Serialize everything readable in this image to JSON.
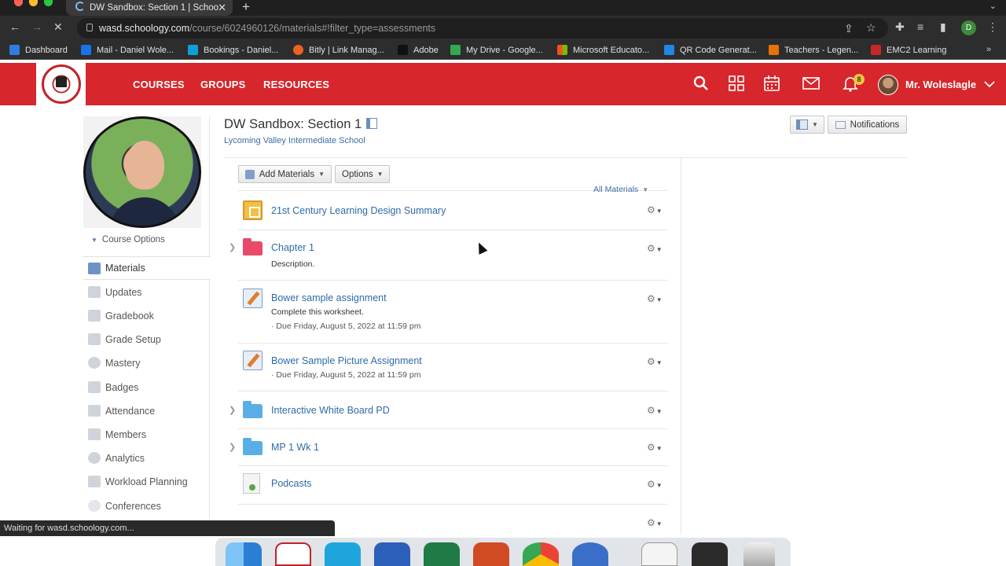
{
  "browser": {
    "tab_title": "DW Sandbox: Section 1 | Schoo",
    "url_host": "wasd.schoology.com",
    "url_path": "/course/6024960126/materials#!filter_type=assessments",
    "profile_letter": "D",
    "bookmarks": [
      {
        "label": "Dashboard",
        "color": "#2f7de1"
      },
      {
        "label": "Mail - Daniel Wole...",
        "color": "#1a73e8"
      },
      {
        "label": "Bookings - Daniel...",
        "color": "#0f9fd8"
      },
      {
        "label": "Bitly | Link Manag...",
        "color": "#ee6123"
      },
      {
        "label": "Adobe",
        "color": "#111111"
      },
      {
        "label": "My Drive - Google...",
        "color": "#34a853"
      },
      {
        "label": "Microsoft Educato...",
        "color": "#f25022"
      },
      {
        "label": "QR Code Generat...",
        "color": "#1e88e5"
      },
      {
        "label": "Teachers - Legen...",
        "color": "#e8710a"
      },
      {
        "label": "EMC2 Learning",
        "color": "#c62828"
      }
    ],
    "status_text": "Waiting for wasd.schoology.com..."
  },
  "header": {
    "nav": [
      "COURSES",
      "GROUPS",
      "RESOURCES"
    ],
    "notification_count": "8",
    "user_name": "Mr. Woleslagle",
    "brand_color": "#d7262c"
  },
  "sidebar": {
    "course_options": "Course Options",
    "items": [
      {
        "label": "Materials",
        "active": true
      },
      {
        "label": "Updates"
      },
      {
        "label": "Gradebook"
      },
      {
        "label": "Grade Setup"
      },
      {
        "label": "Mastery"
      },
      {
        "label": "Badges"
      },
      {
        "label": "Attendance"
      },
      {
        "label": "Members"
      },
      {
        "label": "Analytics"
      },
      {
        "label": "Workload Planning"
      },
      {
        "label": "Conferences"
      }
    ]
  },
  "course": {
    "title": "DW Sandbox: Section 1",
    "school": "Lycoming Valley Intermediate School",
    "notifications_button": "Notifications"
  },
  "toolbar": {
    "add_materials": "Add Materials",
    "options": "Options",
    "filter": "All Materials"
  },
  "materials": [
    {
      "type": "summary",
      "title": "21st Century Learning Design Summary"
    },
    {
      "type": "folder-red",
      "title": "Chapter 1",
      "sub": "Description.",
      "expandable": true
    },
    {
      "type": "assignment",
      "title": "Bower sample assignment",
      "sub": "Complete this worksheet.",
      "due": "· Due Friday, August 5, 2022 at 11:59 pm"
    },
    {
      "type": "assignment",
      "title": "Bower Sample Picture Assignment",
      "due": "· Due Friday, August 5, 2022 at 11:59 pm"
    },
    {
      "type": "folder-blue",
      "title": "Interactive White Board PD",
      "expandable": true
    },
    {
      "type": "folder-blue",
      "title": "MP 1 Wk 1",
      "expandable": true
    },
    {
      "type": "podcast",
      "title": "Podcasts"
    }
  ]
}
